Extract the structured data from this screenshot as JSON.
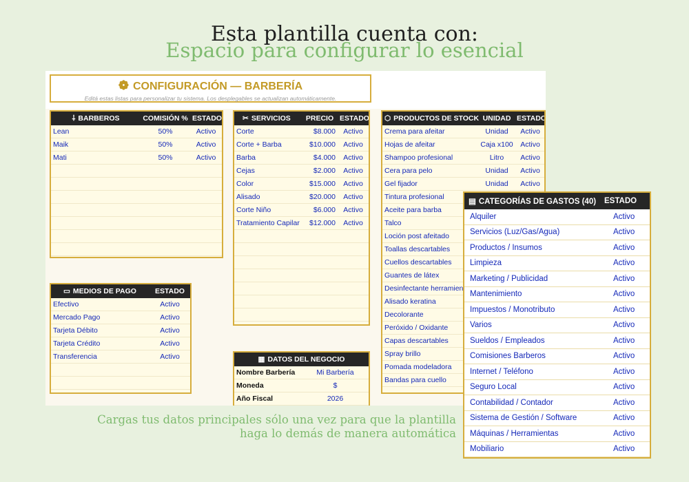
{
  "headline": {
    "line1": "Esta plantilla cuenta con:",
    "line2": "Espacio para configurar lo esencial"
  },
  "config": {
    "icon": "gear-icon",
    "title": "CONFIGURACIÓN — BARBERÍA",
    "subtitle": "Editá estas listas para personalizar tu sistema. Los desplegables se actualizan automáticamente."
  },
  "barberos": {
    "headers": [
      "BARBEROS",
      "COMISIÓN %",
      "ESTADO"
    ],
    "rows": [
      [
        "Lean",
        "50%",
        "Activo"
      ],
      [
        "Maik",
        "50%",
        "Activo"
      ],
      [
        "Mati",
        "50%",
        "Activo"
      ],
      [
        "",
        "",
        ""
      ],
      [
        "",
        "",
        ""
      ],
      [
        "",
        "",
        ""
      ],
      [
        "",
        "",
        ""
      ],
      [
        "",
        "",
        ""
      ],
      [
        "",
        "",
        ""
      ],
      [
        "",
        "",
        ""
      ]
    ]
  },
  "servicios": {
    "headers": [
      "SERVICIOS",
      "PRECIO",
      "ESTADO"
    ],
    "rows": [
      [
        "Corte",
        "$8.000",
        "Activo"
      ],
      [
        "Corte + Barba",
        "$10.000",
        "Activo"
      ],
      [
        "Barba",
        "$4.000",
        "Activo"
      ],
      [
        "Cejas",
        "$2.000",
        "Activo"
      ],
      [
        "Color",
        "$15.000",
        "Activo"
      ],
      [
        "Alisado",
        "$20.000",
        "Activo"
      ],
      [
        "Corte Niño",
        "$6.000",
        "Activo"
      ],
      [
        "Tratamiento Capilar",
        "$12.000",
        "Activo"
      ],
      [
        "",
        "",
        ""
      ],
      [
        "",
        "",
        ""
      ],
      [
        "",
        "",
        ""
      ],
      [
        "",
        "",
        ""
      ],
      [
        "",
        "",
        ""
      ],
      [
        "",
        "",
        ""
      ],
      [
        "",
        "",
        ""
      ]
    ]
  },
  "productos": {
    "headers": [
      "PRODUCTOS DE STOCK",
      "UNIDAD",
      "ESTADO"
    ],
    "rows": [
      [
        "Crema para afeitar",
        "Unidad",
        "Activo"
      ],
      [
        "Hojas de afeitar",
        "Caja x100",
        "Activo"
      ],
      [
        "Shampoo profesional",
        "Litro",
        "Activo"
      ],
      [
        "Cera para pelo",
        "Unidad",
        "Activo"
      ],
      [
        "Gel fijador",
        "Unidad",
        "Activo"
      ],
      [
        "Tintura profesional",
        "",
        ""
      ],
      [
        "Aceite para barba",
        "",
        ""
      ],
      [
        "Talco",
        "",
        ""
      ],
      [
        "Loción post afeitado",
        "",
        ""
      ],
      [
        "Toallas descartables",
        "",
        ""
      ],
      [
        "Cuellos descartables",
        "",
        ""
      ],
      [
        "Guantes de látex",
        "",
        ""
      ],
      [
        "Desinfectante herramien",
        "",
        ""
      ],
      [
        "Alisado keratina",
        "",
        ""
      ],
      [
        "Decolorante",
        "",
        ""
      ],
      [
        "Peróxido / Oxidante",
        "",
        ""
      ],
      [
        "Capas descartables",
        "",
        ""
      ],
      [
        "Spray brillo",
        "",
        ""
      ],
      [
        "Pomada modeladora",
        "",
        ""
      ],
      [
        "Bandas para cuello",
        "",
        ""
      ]
    ]
  },
  "medios_pago": {
    "headers": [
      "MEDIOS DE PAGO",
      "ESTADO"
    ],
    "rows": [
      [
        "Efectivo",
        "Activo"
      ],
      [
        "Mercado Pago",
        "Activo"
      ],
      [
        "Tarjeta Débito",
        "Activo"
      ],
      [
        "Tarjeta Crédito",
        "Activo"
      ],
      [
        "Transferencia",
        "Activo"
      ],
      [
        "",
        ""
      ],
      [
        "",
        ""
      ]
    ]
  },
  "datos_negocio": {
    "header": "DATOS DEL NEGOCIO",
    "rows": [
      [
        "Nombre Barbería",
        "Mi Barbería"
      ],
      [
        "Moneda",
        "$"
      ],
      [
        "Año Fiscal",
        "2026"
      ]
    ]
  },
  "gastos": {
    "headers": [
      "CATEGORÍAS DE GASTOS (40)",
      "ESTADO"
    ],
    "rows": [
      [
        "Alquiler",
        "Activo"
      ],
      [
        "Servicios (Luz/Gas/Agua)",
        "Activo"
      ],
      [
        "Productos / Insumos",
        "Activo"
      ],
      [
        "Limpieza",
        "Activo"
      ],
      [
        "Marketing / Publicidad",
        "Activo"
      ],
      [
        "Mantenimiento",
        "Activo"
      ],
      [
        "Impuestos / Monotributo",
        "Activo"
      ],
      [
        "Varios",
        "Activo"
      ],
      [
        "Sueldos / Empleados",
        "Activo"
      ],
      [
        "Comisiones Barberos",
        "Activo"
      ],
      [
        "Internet / Teléfono",
        "Activo"
      ],
      [
        "Seguro Local",
        "Activo"
      ],
      [
        "Contabilidad / Contador",
        "Activo"
      ],
      [
        "Sistema de Gestión / Software",
        "Activo"
      ],
      [
        "Máquinas / Herramientas",
        "Activo"
      ],
      [
        "Mobiliario",
        "Activo"
      ]
    ]
  },
  "footer": {
    "line1": "Cargas tus datos principales sólo una vez para que la plantilla",
    "line2": "haga lo demás de manera automática"
  }
}
